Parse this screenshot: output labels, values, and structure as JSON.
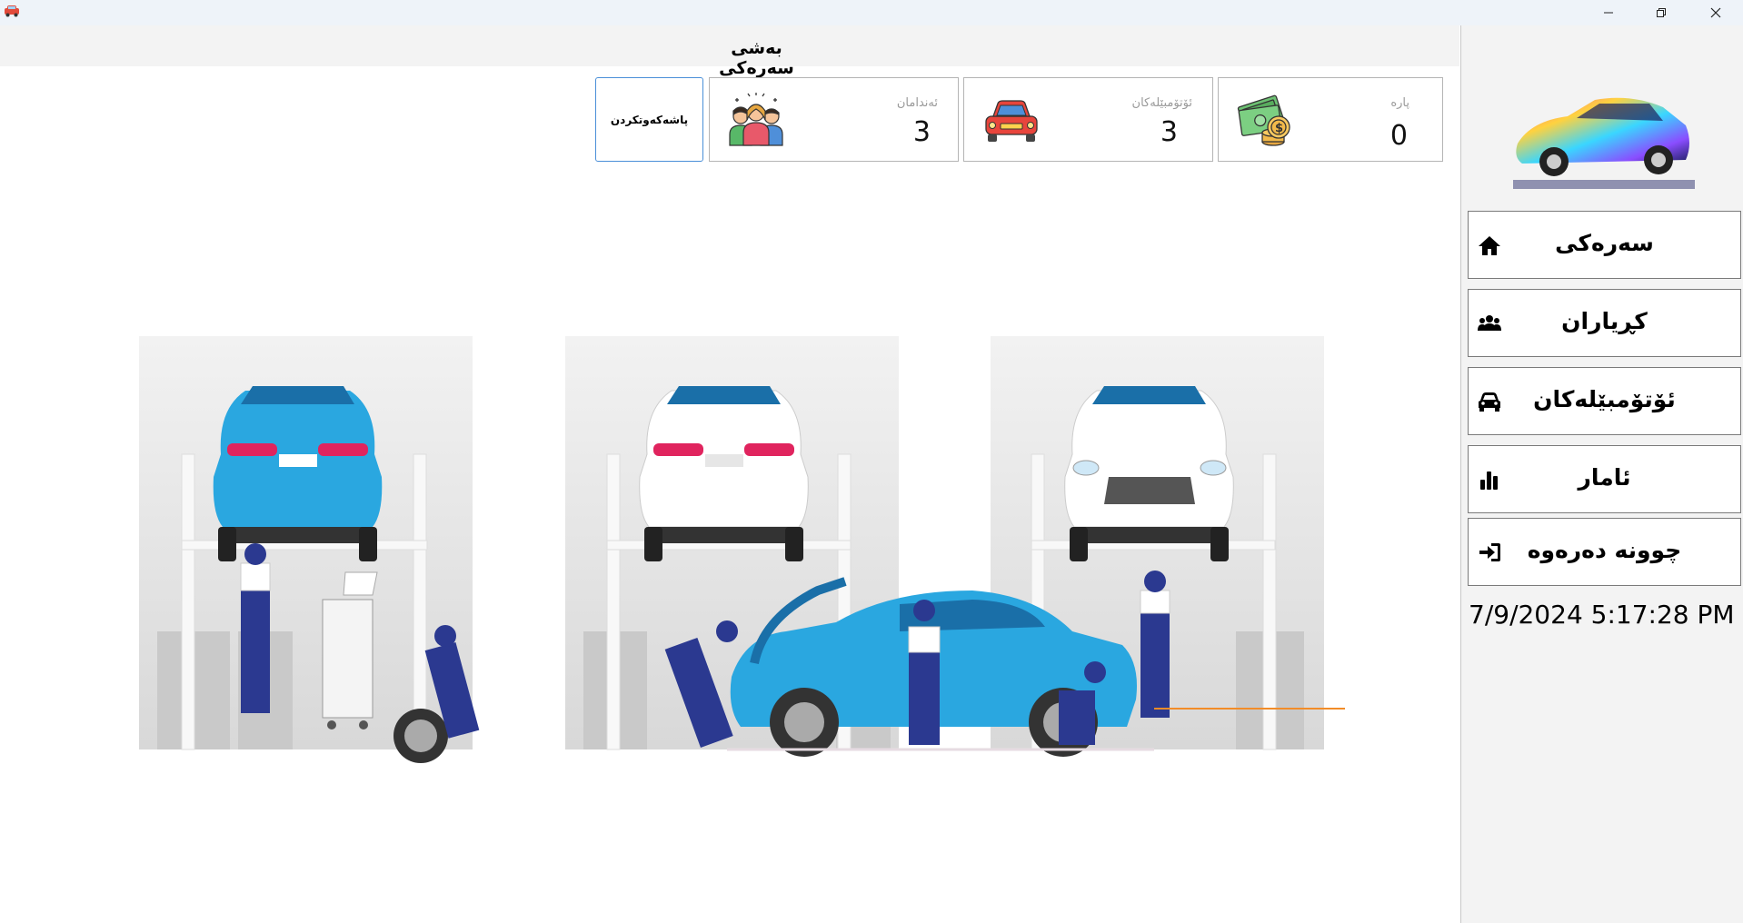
{
  "header": {
    "title": "بەشی سەرەکی"
  },
  "cards": [
    {
      "label": "پارە",
      "value": "0",
      "icon": "money-icon"
    },
    {
      "label": "ئۆتۆمبێلەکان",
      "value": "3",
      "icon": "car-icon"
    },
    {
      "label": "ئەندامان",
      "value": "3",
      "icon": "team-icon"
    }
  ],
  "backup": {
    "label": "پاشەکەوتکردن"
  },
  "sidebar": {
    "items": [
      {
        "label": "سەرەکی",
        "icon": "home-icon"
      },
      {
        "label": "کڕیاران",
        "icon": "users-icon"
      },
      {
        "label": "ئۆتۆمبێلەکان",
        "icon": "car-icon"
      },
      {
        "label": "ئامار",
        "icon": "bar-chart-icon"
      },
      {
        "label": "چوونە دەرەوە",
        "icon": "sign-in-icon"
      }
    ],
    "datetime": "7/9/2024 5:17:28 PM"
  },
  "colors": {
    "accent": "#4a8fd8",
    "car_blue": "#2aa7e0",
    "uniform": "#2b3990",
    "panel_gray": "#e6e6e6"
  }
}
